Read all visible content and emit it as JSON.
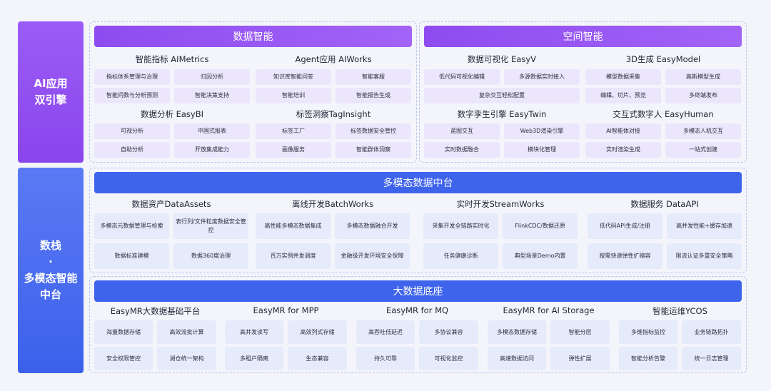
{
  "left_labels": {
    "ai": [
      "AI应用",
      "双引擎"
    ],
    "data": [
      "数栈",
      "·",
      "多模态智能",
      "中台"
    ]
  },
  "sections": {
    "shuju_zhineng": {
      "title": "数据智能",
      "groups": [
        {
          "title": "智能指标 AIMetrics",
          "items": [
            "指标体系管理与治理",
            "归因分析",
            "智能问数与分析预测",
            "智能决策支持"
          ]
        },
        {
          "title": "Agent应用 AIWorks",
          "items": [
            "知识库智能问答",
            "智能客服",
            "智能培训",
            "智能报告生成"
          ]
        },
        {
          "title": "数据分析 EasyBI",
          "items": [
            "可视分析",
            "中国式报表",
            "自助分析",
            "开放集成能力"
          ]
        },
        {
          "title": "标签洞察TagInsight",
          "items": [
            "标签工厂",
            "标签数据安全管控",
            "画像服务",
            "智能群体洞察"
          ]
        }
      ]
    },
    "kongjian_zhineng": {
      "title": "空间智能",
      "groups": [
        {
          "title": "数据可视化 EasyV",
          "items": [
            "低代码可视化编辑",
            "多源数据实时接入",
            "复杂交互轻松配置"
          ]
        },
        {
          "title": "3D生成 EasyModel",
          "items": [
            "模型数据采集",
            "高斯模型生成",
            "编辑、切片、预览",
            "多终端发布"
          ]
        },
        {
          "title": "数字孪生引擎 EasyTwin",
          "items": [
            "蓝图交互",
            "Web3D渲染引擎",
            "实时数据融合",
            "模块化管理"
          ]
        },
        {
          "title": "交互式数字人 EasyHuman",
          "items": [
            "AI智能体对接",
            "多模态人机交互",
            "实时渲染生成",
            "一站式创建"
          ]
        }
      ]
    },
    "duomotai": {
      "title": "多模态数据中台",
      "groups": [
        {
          "title": "数据资产DataAssets",
          "items": [
            "多模态元数据管理与检索",
            "表行列/文件粒度数据安全管控",
            "数据标准建模",
            "数据360度治理"
          ]
        },
        {
          "title": "离线开发BatchWorks",
          "items": [
            "高性能多模态数据集成",
            "多模态数据融合开发",
            "百万实例并发调度",
            "金融级开发环境安全保障"
          ]
        },
        {
          "title": "实时开发StreamWorks",
          "items": [
            "采集开发全链路实时化",
            "FlinkCDC/数据还原",
            "任务健康诊断",
            "典型场景Demo内置"
          ]
        },
        {
          "title": "数据服务 DataAPI",
          "items": [
            "低代码API生成/注册",
            "高并发性能+缓存加速",
            "按需快速弹性扩缩容",
            "限流认证多重安全策略"
          ]
        }
      ]
    },
    "dashuju": {
      "title": "大数据底座",
      "groups": [
        {
          "title": "EasyMR大数据基础平台",
          "items": [
            "海量数据存储",
            "高效流批计算",
            "安全权限管控",
            "湖仓统一架构"
          ]
        },
        {
          "title": "EasyMR for MPP",
          "items": [
            "高并发读写",
            "高效列式存储",
            "多租户隔离",
            "生态兼容"
          ]
        },
        {
          "title": "EasyMR for MQ",
          "items": [
            "高吞吐低延迟",
            "多协议兼容",
            "持久可靠",
            "可视化监控"
          ]
        },
        {
          "title": "EasyMR for AI Storage",
          "items": [
            "多模态数据存储",
            "智能分层",
            "高速数据访问",
            "弹性扩展"
          ]
        },
        {
          "title": "智能运维YCOS",
          "items": [
            "多维指标监控",
            "业务链路拓扑",
            "智能分析告警",
            "统一日志管理"
          ]
        }
      ]
    }
  },
  "colors": {
    "purple_bar": "#8e4cf0",
    "blue_bar": "#3f64ec",
    "purple_cell": "#ebe6fb",
    "blue_cell": "#e6ebfb"
  }
}
